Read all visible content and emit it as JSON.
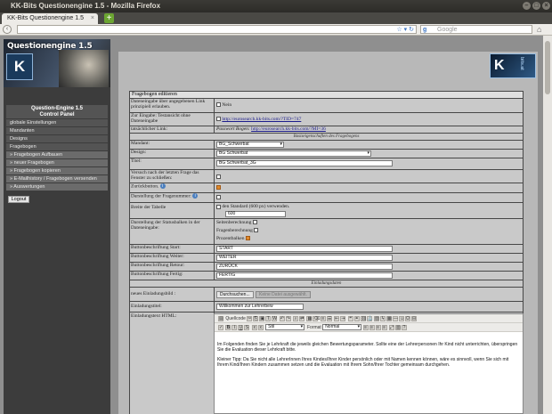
{
  "window": {
    "title": "KK-Bits Questionengine 1.5 - Mozilla Firefox"
  },
  "tabs": [
    {
      "label": "KK-Bits Questionengine 1.5"
    }
  ],
  "search": {
    "placeholder": "Google"
  },
  "sidebar": {
    "logo_title": "Questionengine 1.5",
    "panel_title": "Question-Engine 1.5",
    "panel_sub": "Control Panel",
    "items": [
      {
        "label": "globale Einstellungen"
      },
      {
        "label": "Mandanten"
      },
      {
        "label": "Designs"
      },
      {
        "label": "Fragebogen"
      },
      {
        "label": "» Fragebogen Aufbauen"
      },
      {
        "label": "» neuer Fragebogen"
      },
      {
        "label": "» Fragebogen kopieren"
      },
      {
        "label": "» E-Mailhistory / Fragebogen versenden"
      },
      {
        "label": "» Auswertungen"
      }
    ],
    "logout": "Logout"
  },
  "form": {
    "header": "Fragebogen editieren",
    "rows": {
      "ungeprueft": {
        "label": "Dateneingabe über angegebenen Link prinzipiell erlauben.",
        "value": "Nein"
      },
      "zur_eingabe": {
        "label": "Zur Eingabe: Testansicht ohne Dateneingabe",
        "link": "http://eurosearch.kk-bits.com/?TID=747"
      },
      "tatsaechlich": {
        "label": "tatsächlicher Link:",
        "prefix": "Passwort Bogen:",
        "link": "http://eurosearch.kk-bits.com/?MI=36"
      },
      "section_grund": "Basiseigenschaften des Fragebogens",
      "mandant": {
        "label": "Mandant:",
        "value": "BG_Schwerbat"
      },
      "design": {
        "label": "Design:",
        "value": "BG Schwerbat"
      },
      "titel": {
        "label": "Titel:",
        "value": "BG Schwerbat_3G"
      },
      "versuch": {
        "label": "Versuch nach der letzten Frage das Fenster zu schließen:"
      },
      "zurueck": {
        "label": "Zurückbutton."
      },
      "darstellung": {
        "label": "Darstellung der Fragenummer:"
      },
      "breite": {
        "label": "Breite der Tabelle",
        "value_text": "den Standard (600 px) verwenden.",
        "value": "600"
      },
      "statusbalken": {
        "label": "Darstellung der Statusbalken in der Dateneingabe:",
        "options": [
          "Seitenberechnung",
          "Fragenberechnung",
          "Prozentbalken"
        ]
      },
      "btn_start": {
        "label": "Buttonbeschriftung Start:",
        "value": "START"
      },
      "btn_weiter": {
        "label": "Buttonbeschriftung Weiter:",
        "value": "WEITER"
      },
      "btn_retour": {
        "label": "Buttonbeschriftung Retour:",
        "value": "ZURÜCK"
      },
      "btn_fertig": {
        "label": "Buttonbeschriftung Fertig:",
        "value": "FERTIG"
      },
      "section_einladung": "Einladungsdaten",
      "einladungsbild": {
        "label": "neues Einladungsbild :",
        "browse": "Durchsuchen...",
        "none": "Keine Datei ausgewählt."
      },
      "einladungstitel": {
        "label": "Einladungstitel:",
        "value": "Willkommen zur Lehrerbew"
      },
      "einladungstext": {
        "label": "Einladungstext HTML:"
      }
    }
  },
  "editor": {
    "toolbar": {
      "source": "Quellcode",
      "style": "Stil",
      "format": "Format",
      "format_value": "Normal"
    },
    "paragraphs": [
      "Im Folgenden finden Sie je Lehrkraft die jeweils gleichen Bewertungsparameter. Sollte eine der Lehrerpersonen Ihr Kind nicht unterrichten, überspringen Sie die Evaluation dieser Lehrkraft bitte.",
      "Kleiner Tipp: Da Sie nicht alle LehrerInnen Ihres Kindes/Ihrer Kinder persönlich oder mit Namen kennen können, wäre es sinnvoll, wenn Sie sich mit Ihrem Kind/Ihren Kindern zusammen setzen und die Evaluation mit Ihrem Sohn/Ihrer Tochter gemeinsam durchgehen."
    ]
  }
}
